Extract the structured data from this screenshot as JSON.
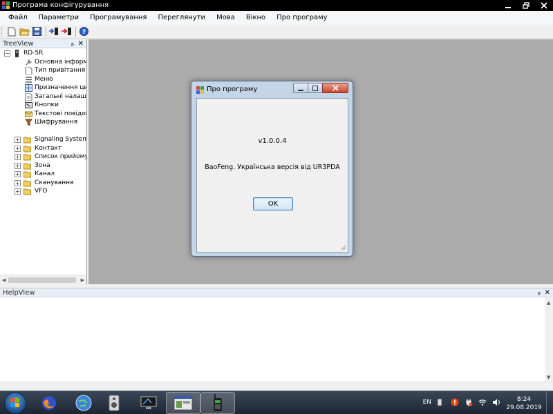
{
  "window": {
    "title": "Програма конфігурування"
  },
  "menu": [
    "Файл",
    "Параметри",
    "Програмування",
    "Переглянути",
    "Мова",
    "Вікно",
    "Про програму"
  ],
  "toolbar": {
    "icons": [
      "new-file-icon",
      "open-folder-icon",
      "save-icon",
      "read-from-radio-icon",
      "write-to-radio-icon",
      "help-icon"
    ]
  },
  "treeview": {
    "title": "TreeView",
    "pin": "ᵦ",
    "close": "✕",
    "root": "RD-5R",
    "items": [
      {
        "label": "Основна інформац",
        "icon": "wrench-icon"
      },
      {
        "label": "Тип привітання",
        "icon": "document-icon"
      },
      {
        "label": "Меню",
        "icon": "menu-list-icon"
      },
      {
        "label": "Призначення цифр",
        "icon": "grid-icon"
      },
      {
        "label": "Загальні налаштув",
        "icon": "document-icon"
      },
      {
        "label": "Кнопки",
        "icon": "button-icon"
      },
      {
        "label": "Текстові повідомл",
        "icon": "message-icon"
      },
      {
        "label": "Шифрування",
        "icon": "lock-icon"
      }
    ],
    "folders": [
      "Signaling System",
      "Контакт",
      "Список прийому",
      "Зона",
      "Канал",
      "Сканування",
      "VFO"
    ]
  },
  "dialog": {
    "title": "Про програму",
    "version": "v1.0.0.4",
    "description": "BaoFeng. Українська версія від UR3PDA",
    "ok": "OK"
  },
  "helpview": {
    "title": "HelpView",
    "pin": "ᵦ",
    "close": "✕"
  },
  "taskbar": {
    "language": "EN",
    "time": "8:24",
    "date": "29.08.2019"
  }
}
